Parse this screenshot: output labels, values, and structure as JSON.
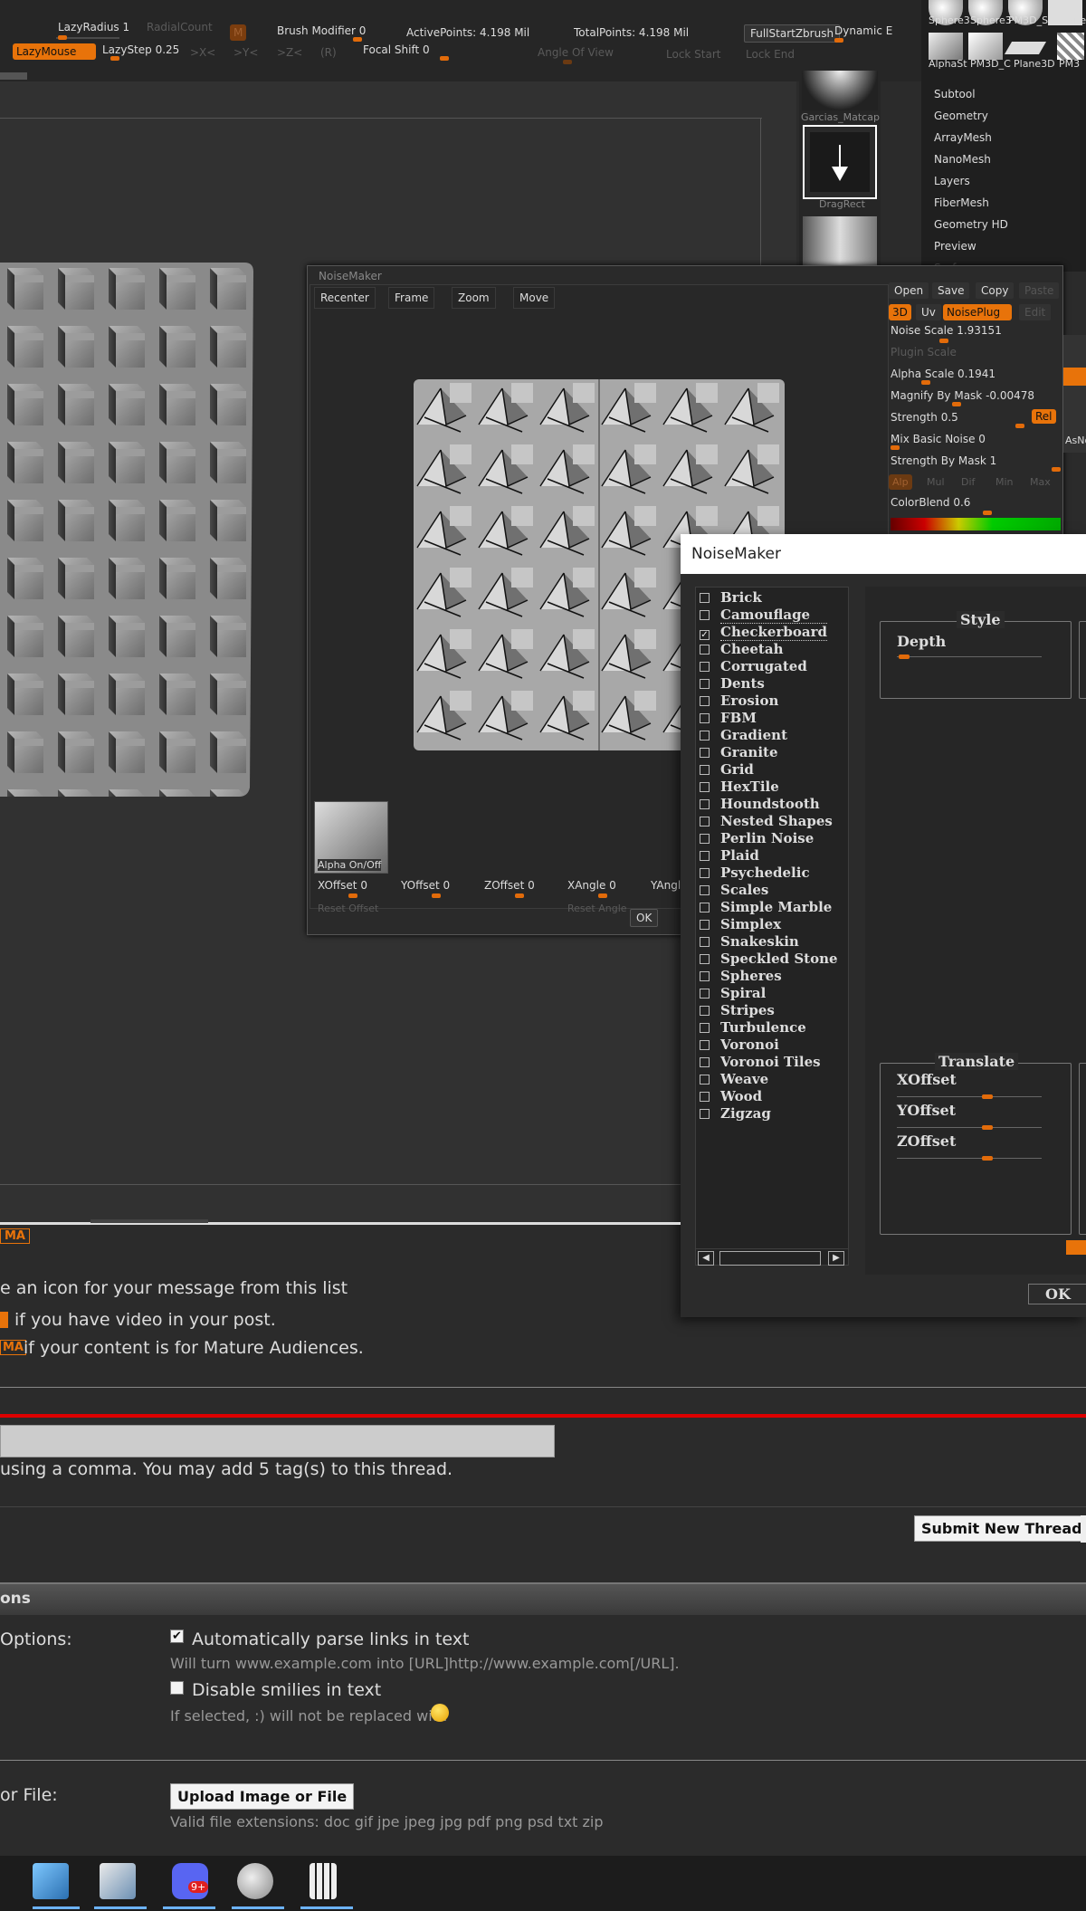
{
  "toolbar": {
    "lazy_radius": "LazyRadius 1",
    "radial_count": "RadialCount",
    "mask_btn": "M",
    "brush_modifier": "Brush Modifier 0",
    "active_points": "ActivePoints: 4.198 Mil",
    "total_points": "TotalPoints: 4.198 Mil",
    "full_start": "FullStartZbrush",
    "dynamic": "Dynamic E",
    "lazy_mouse": "LazyMouse",
    "lazy_step": "LazyStep 0.25",
    "x": ">X<",
    "y": ">Y<",
    "z": ">Z<",
    "r": "(R)",
    "focal_shift": "Focal Shift 0",
    "angle_of_view": "Angle Of View",
    "lock_start": "Lock Start",
    "lock_end": "Lock End"
  },
  "thumbs": {
    "top_labels": [
      "Sphere3",
      "Sphere3",
      "PM3D_S",
      "Plane"
    ],
    "bottom_labels": [
      "AlphaSt",
      "PM3D_C",
      "Plane3D",
      "PM3"
    ],
    "matcap": "Garcias_Matcap",
    "dragrect": "DragRect"
  },
  "subtool_menu": [
    "Subtool",
    "Geometry",
    "ArrayMesh",
    "NanoMesh",
    "Layers",
    "FiberMesh",
    "Geometry HD",
    "Preview",
    "Surface"
  ],
  "noisemaker_bg": {
    "title": "NoiseMaker",
    "nav": [
      "Recenter",
      "Frame",
      "Zoom",
      "Move"
    ],
    "buttons": [
      "Open",
      "Save",
      "Copy",
      "Paste"
    ],
    "mode": [
      "3D",
      "Uv",
      "NoisePlug",
      "Edit"
    ],
    "noise_scale": "Noise Scale  1.93151",
    "plugin_scale": "Plugin Scale",
    "alpha_scale": "Alpha Scale  0.1941",
    "magnify": "Magnify By Mask -0.00478",
    "strength": "Strength 0.5",
    "rel": "Rel",
    "mix_basic": "Mix Basic Noise 0",
    "strength_mask": "Strength By Mask 1",
    "blend_modes": [
      "Alp",
      "Mul",
      "Dif",
      "Min",
      "Max"
    ],
    "color_blend": "ColorBlend 0.6",
    "alpha_onoff": "Alpha On/Off",
    "offsets": [
      "XOffset 0",
      "YOffset 0",
      "ZOffset 0",
      "XAngle 0",
      "YAngle"
    ],
    "reset_offset": "Reset Offset",
    "reset_angle": "Reset Angle",
    "ok": "OK",
    "side_labels": [
      "AsNo"
    ]
  },
  "dialog": {
    "title": "NoiseMaker",
    "items": [
      "Brick",
      "Camouflage",
      "Checkerboard",
      "Cheetah",
      "Corrugated",
      "Dents",
      "Erosion",
      "FBM",
      "Gradient",
      "Granite",
      "Grid",
      "HexTile",
      "Houndstooth",
      "Nested Shapes",
      "Perlin Noise",
      "Plaid",
      "Psychedelic",
      "Scales",
      "Simple Marble",
      "Simplex",
      "Snakeskin",
      "Speckled Stone",
      "Spheres",
      "Spiral",
      "Stripes",
      "Turbulence",
      "Voronoi",
      "Voronoi Tiles",
      "Weave",
      "Wood",
      "Zigzag"
    ],
    "checked_item": "Checkerboard",
    "style_group": "Style",
    "depth": "Depth",
    "translate_group": "Translate",
    "xoffset": "XOffset",
    "yoffset": "YOffset",
    "zoffset": "ZOffset",
    "ok": "OK"
  },
  "forum": {
    "ma_badge": "MA",
    "icon_text": "e an icon for your message from this list",
    "video_text": "if you have video in your post.",
    "ma_text": "if your content is for Mature Audiences.",
    "tag_hint": "using a comma. You may add 5 tag(s) to this thread.",
    "submit": "Submit New Thread",
    "section": "ons",
    "options_label": "Options:",
    "parse_links": "Automatically parse links in text",
    "parse_hint": "Will turn www.example.com into [URL]http://www.example.com[/URL].",
    "disable_smilies": "Disable smilies in text",
    "smilies_hint": "If selected, :) will not be replaced with",
    "file_label": "or File:",
    "upload": "Upload Image or File",
    "extensions": "Valid file extensions: doc gif jpe jpeg jpg pdf png psd txt zip"
  },
  "taskbar": {
    "badge": "9+"
  }
}
